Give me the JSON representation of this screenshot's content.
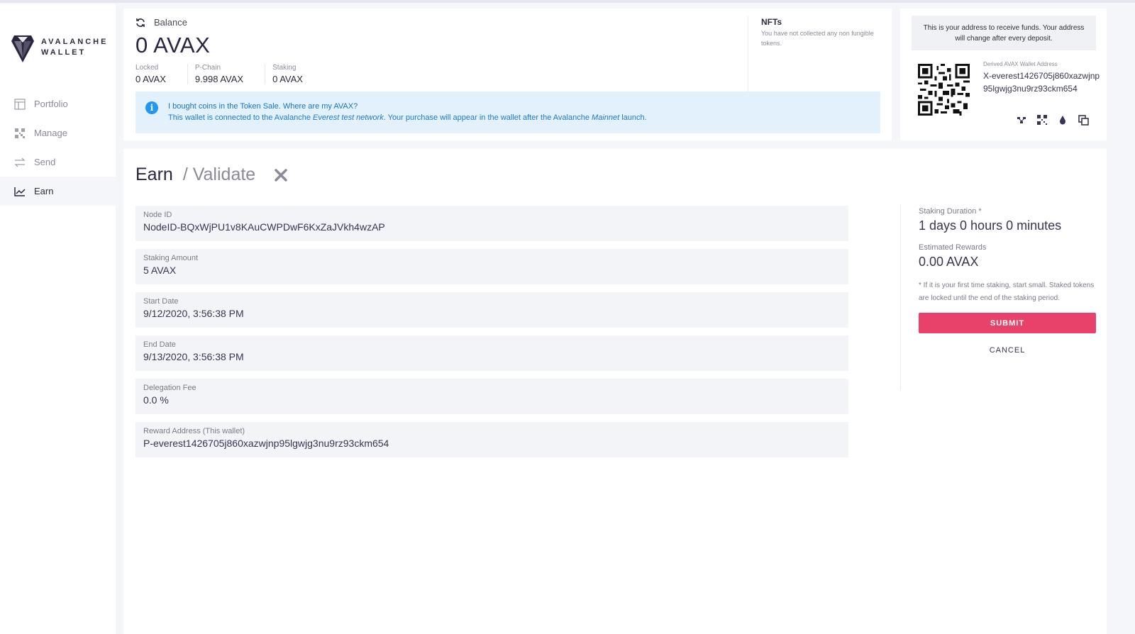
{
  "app": {
    "logo_line1": "AVALANCHE",
    "logo_line2": "WALLET"
  },
  "sidebar": {
    "items": [
      {
        "label": "Portfolio",
        "icon": "portfolio-icon",
        "active": false
      },
      {
        "label": "Manage",
        "icon": "manage-icon",
        "active": false
      },
      {
        "label": "Send",
        "icon": "send-icon",
        "active": false
      },
      {
        "label": "Earn",
        "icon": "earn-icon",
        "active": true
      }
    ]
  },
  "balance": {
    "heading": "Balance",
    "amount": "0 AVAX",
    "locked_label": "Locked",
    "locked_value": "0 AVAX",
    "pchain_label": "P-Chain",
    "pchain_value": "9.998 AVAX",
    "staking_label": "Staking",
    "staking_value": "0 AVAX"
  },
  "nfts": {
    "title": "NFTs",
    "subtitle": "You have not collected any non fungible tokens."
  },
  "banner": {
    "line1": "I bought coins in the Token Sale. Where are my AVAX?",
    "line2_a": "This wallet is connected to the Avalanche ",
    "line2_b": "Everest test network",
    "line2_c": ". Your purchase will appear in the wallet after the Avalanche ",
    "line2_d": "Mainnet",
    "line2_e": " launch."
  },
  "address": {
    "note": "This is your address to receive funds. Your address will change after every deposit.",
    "label": "Derived AVAX Wallet Address",
    "value": "X-everest1426705j860xazwjnp95lgwjg3nu9rz93ckm654"
  },
  "earn": {
    "title": "Earn",
    "subtitle": "/ Validate",
    "fields": [
      {
        "label": "Node ID",
        "value": "NodeID-BQxWjPU1v8KAuCWPDwF6KxZaJVkh4wzAP"
      },
      {
        "label": "Staking Amount",
        "value": "5 AVAX"
      },
      {
        "label": "Start Date",
        "value": "9/12/2020, 3:56:38 PM"
      },
      {
        "label": "End Date",
        "value": "9/13/2020, 3:56:38 PM"
      },
      {
        "label": "Delegation Fee",
        "value": "0.0 %"
      },
      {
        "label": "Reward Address (This wallet)",
        "value": "P-everest1426705j860xazwjnp95lgwjg3nu9rz93ckm654"
      }
    ],
    "duration_label": "Staking Duration *",
    "duration_value": "1 days 0 hours 0 minutes",
    "rewards_label": "Estimated Rewards",
    "rewards_value": "0.00 AVAX",
    "note": "* If it is your first time staking, start small. Staked tokens are locked until the end of the staking period.",
    "submit": "SUBMIT",
    "cancel": "CANCEL"
  },
  "colors": {
    "accent": "#e8426b",
    "info_bg": "#e3f1fc",
    "info_text": "#1475c4",
    "brand": "#2a2540"
  }
}
